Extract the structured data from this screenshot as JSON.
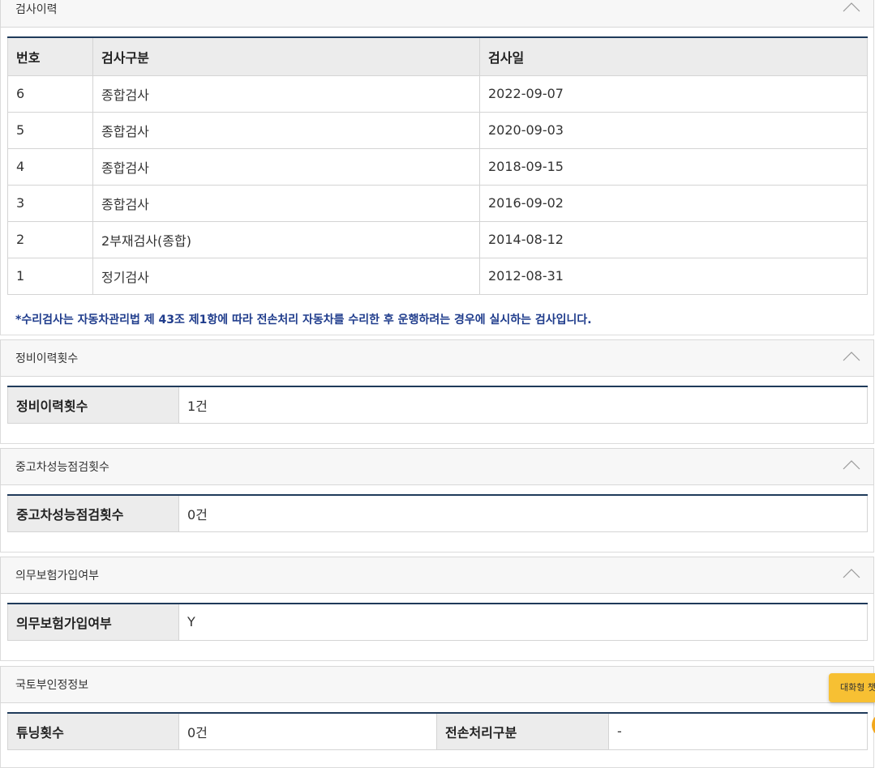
{
  "inspection_history": {
    "title": "검사이력",
    "headers": [
      "번호",
      "검사구분",
      "검사일"
    ],
    "rows": [
      [
        "6",
        "종합검사",
        "2022-09-07"
      ],
      [
        "5",
        "종합검사",
        "2020-09-03"
      ],
      [
        "4",
        "종합검사",
        "2018-09-15"
      ],
      [
        "3",
        "종합검사",
        "2016-09-02"
      ],
      [
        "2",
        "2부재검사(종합)",
        "2014-08-12"
      ],
      [
        "1",
        "정기검사",
        "2012-08-31"
      ]
    ],
    "note": "*수리검사는 자동차관리법 제 43조 제1항에 따라 전손처리 자동차를 수리한 후 운행하려는 경우에 실시하는 검사입니다."
  },
  "maintenance": {
    "title": "정비이력횟수",
    "label": "정비이력횟수",
    "value": "1건"
  },
  "used_car_check": {
    "title": "중고차성능점검횟수",
    "label": "중고차성능점검횟수",
    "value": "0건"
  },
  "insurance": {
    "title": "의무보험가입여부",
    "label": "의무보험가입여부",
    "value": "Y"
  },
  "molit_cert": {
    "title": "국토부인정정보",
    "tuning_label": "튜닝횟수",
    "tuning_value": "0건",
    "total_loss_label": "전손처리구분",
    "total_loss_value": "-"
  },
  "chat": {
    "label": "대화형 챗봇"
  },
  "colors": {
    "accent_border": "#1f3a5a",
    "note_text": "#1f3c8c",
    "chat_button": "#f7c033"
  }
}
